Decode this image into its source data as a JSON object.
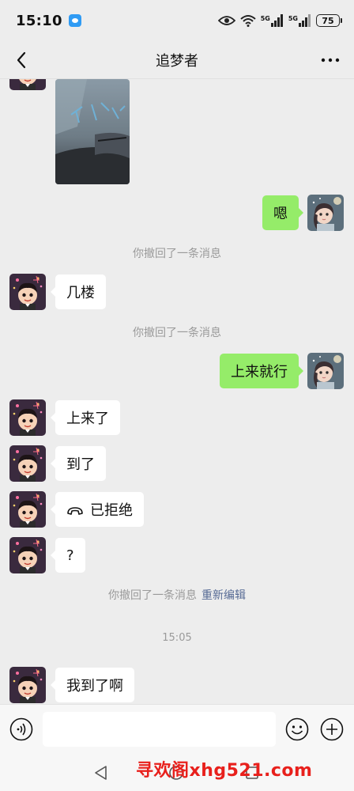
{
  "status_bar": {
    "time": "15:10",
    "net1": "5G",
    "net2": "5G",
    "battery": "75"
  },
  "header": {
    "title": "追梦者",
    "back_icon": "chevron-left-icon",
    "more_icon": "more-dots-icon"
  },
  "messages": [
    {
      "type": "image",
      "side": "left",
      "content": "photo"
    },
    {
      "type": "text",
      "side": "right",
      "text": "嗯"
    },
    {
      "type": "system",
      "text": "你撤回了一条消息"
    },
    {
      "type": "text",
      "side": "left",
      "text": "几楼"
    },
    {
      "type": "system",
      "text": "你撤回了一条消息"
    },
    {
      "type": "text",
      "side": "right",
      "text": "上来就行"
    },
    {
      "type": "text",
      "side": "left",
      "text": "上来了"
    },
    {
      "type": "text",
      "side": "left",
      "text": "到了"
    },
    {
      "type": "call",
      "side": "left",
      "text": "已拒绝"
    },
    {
      "type": "text",
      "side": "left",
      "text": "?"
    },
    {
      "type": "system",
      "text": "你撤回了一条消息",
      "link": "重新编辑"
    },
    {
      "type": "timestamp",
      "text": "15:05"
    },
    {
      "type": "text",
      "side": "left",
      "text": "我到了啊"
    }
  ],
  "input_bar": {
    "placeholder": "",
    "voice_icon": "voice-icon",
    "emoji_icon": "emoji-icon",
    "plus_icon": "plus-icon"
  },
  "watermark": "寻欢阁xhg521.com",
  "colors": {
    "background": "#ededed",
    "outgoing_bubble": "#95ec69",
    "incoming_bubble": "#ffffff",
    "link": "#576b95",
    "watermark": "#e8201c"
  }
}
